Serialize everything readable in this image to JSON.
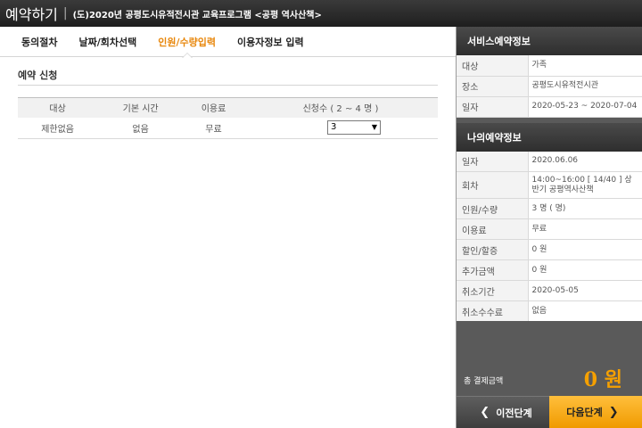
{
  "header": {
    "title": "예약하기",
    "separator": "|",
    "program": "(도)2020년 공평도시유적전시관 교육프로그램 <공평 역사산책>"
  },
  "tabs": [
    {
      "label": "동의절차",
      "active": false
    },
    {
      "label": "날짜/회차선택",
      "active": false
    },
    {
      "label": "인원/수량입력",
      "active": true
    },
    {
      "label": "이용자정보 입력",
      "active": false
    }
  ],
  "section": {
    "title": "예약 신청",
    "columns": [
      "대상",
      "기본 시간",
      "이용료",
      "신청수 ( 2 ~ 4 명 )"
    ],
    "row": {
      "target": "제한없음",
      "base_time": "없음",
      "fee": "무료",
      "quantity_selected": "3"
    }
  },
  "service_info": {
    "title": "서비스예약정보",
    "rows": [
      {
        "label": "대상",
        "value": "가족"
      },
      {
        "label": "장소",
        "value": "공평도시유적전시관"
      },
      {
        "label": "일자",
        "value": "2020-05-23 ~ 2020-07-04"
      }
    ]
  },
  "my_info": {
    "title": "나의예약정보",
    "rows": [
      {
        "label": "일자",
        "value": "2020.06.06"
      },
      {
        "label": "회차",
        "value": "14:00~16:00 [ 14/40 ] 상반기 공평역사산책"
      },
      {
        "label": "인원/수량",
        "value": "3 명 ( 명)"
      },
      {
        "label": "이용료",
        "value": "무료"
      },
      {
        "label": "할인/할증",
        "value": "0 원"
      },
      {
        "label": "추가금액",
        "value": "0 원"
      },
      {
        "label": "취소기간",
        "value": "2020-05-05"
      },
      {
        "label": "취소수수료",
        "value": "없음"
      }
    ]
  },
  "total": {
    "label": "총 결제금액",
    "amount": "0 원"
  },
  "buttons": {
    "prev": "이전단계",
    "next": "다음단계"
  },
  "colors": {
    "accent": "#e8870c",
    "next_button": "#f5a000",
    "side_panel": "#5a5a5a"
  },
  "icons": {
    "prev": "chevron-left-icon",
    "next": "chevron-right-icon",
    "select_arrow": "caret-down-icon"
  }
}
